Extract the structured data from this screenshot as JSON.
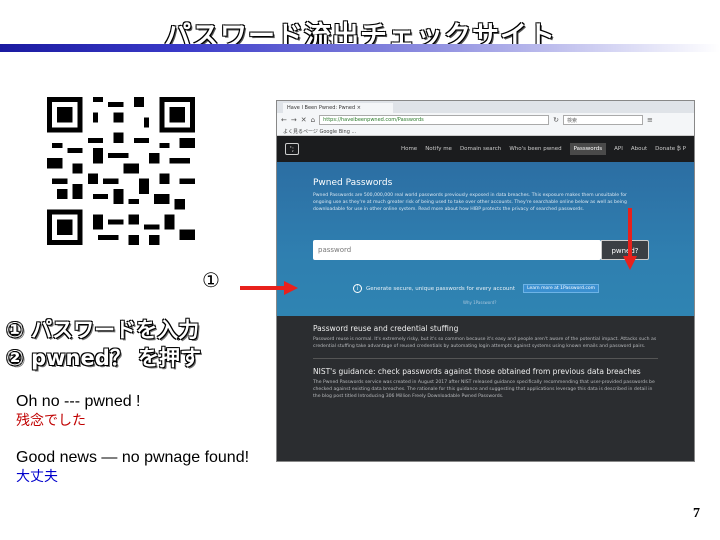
{
  "slide": {
    "title": "パスワード流出チェックサイト",
    "step_marker_1": "①",
    "step_marker_2": "②",
    "steps": [
      "① パスワードを入力",
      "②  pwned？  を押す"
    ],
    "results": [
      {
        "en": "Oh no --- pwned !",
        "jp": "残念でした"
      },
      {
        "en": "Good news — no pwnage found!",
        "jp": "大丈夫"
      }
    ],
    "page_number": "7"
  },
  "colors": {
    "arrow": "#e8211c",
    "title_bar": "#3a3ac8",
    "hero": "#2f7fb0",
    "jp_bad": "#c00000",
    "jp_good": "#0000cc"
  },
  "browser": {
    "tab_title": "Have I Been Pwned: Pwned ×",
    "url": "https://haveibeenpwned.com/Passwords",
    "search_placeholder": "検索",
    "bookmarks": "よく見るページ  Google  Bing  ...",
    "nav": {
      "logo": "';",
      "links": [
        "Home",
        "Notify me",
        "Domain search",
        "Who's been pwned",
        "Passwords",
        "API",
        "About",
        "Donate ₿ P"
      ],
      "active": "Passwords"
    },
    "hero": {
      "heading": "Pwned Passwords",
      "description": "Pwned Passwords are 500,000,000 real world passwords previously exposed in data breaches. This exposure makes them unsuitable for ongoing use as they're at much greater risk of being used to take over other accounts. They're searchable online below as well as being downloadable for use in other online system. Read more about how HIBP protects the privacy of searched passwords.",
      "password_placeholder": "password",
      "pwned_button": "pwned?",
      "generate_text": "Generate secure, unique passwords for every account",
      "generate_button": "Learn more at 1Password.com",
      "why_text": "Why 1Password?"
    },
    "sections": [
      {
        "heading": "Password reuse and credential stuffing",
        "body": "Password reuse is normal. It's extremely risky, but it's so common because it's easy and people aren't aware of the potential impact. Attacks such as credential stuffing take advantage of reused credentials by automating login attempts against systems using known emails and password pairs."
      },
      {
        "heading": "NIST's guidance: check passwords against those obtained from previous data breaches",
        "body": "The Pwned Passwords service was created in August 2017 after NIST released guidance specifically recommending that user-provided passwords be checked against existing data breaches. The rationale for this guidance and suggesting that applications leverage this data is described in detail in the blog post titled Introducing 306 Million Freely Downloadable Pwned Passwords."
      }
    ]
  }
}
